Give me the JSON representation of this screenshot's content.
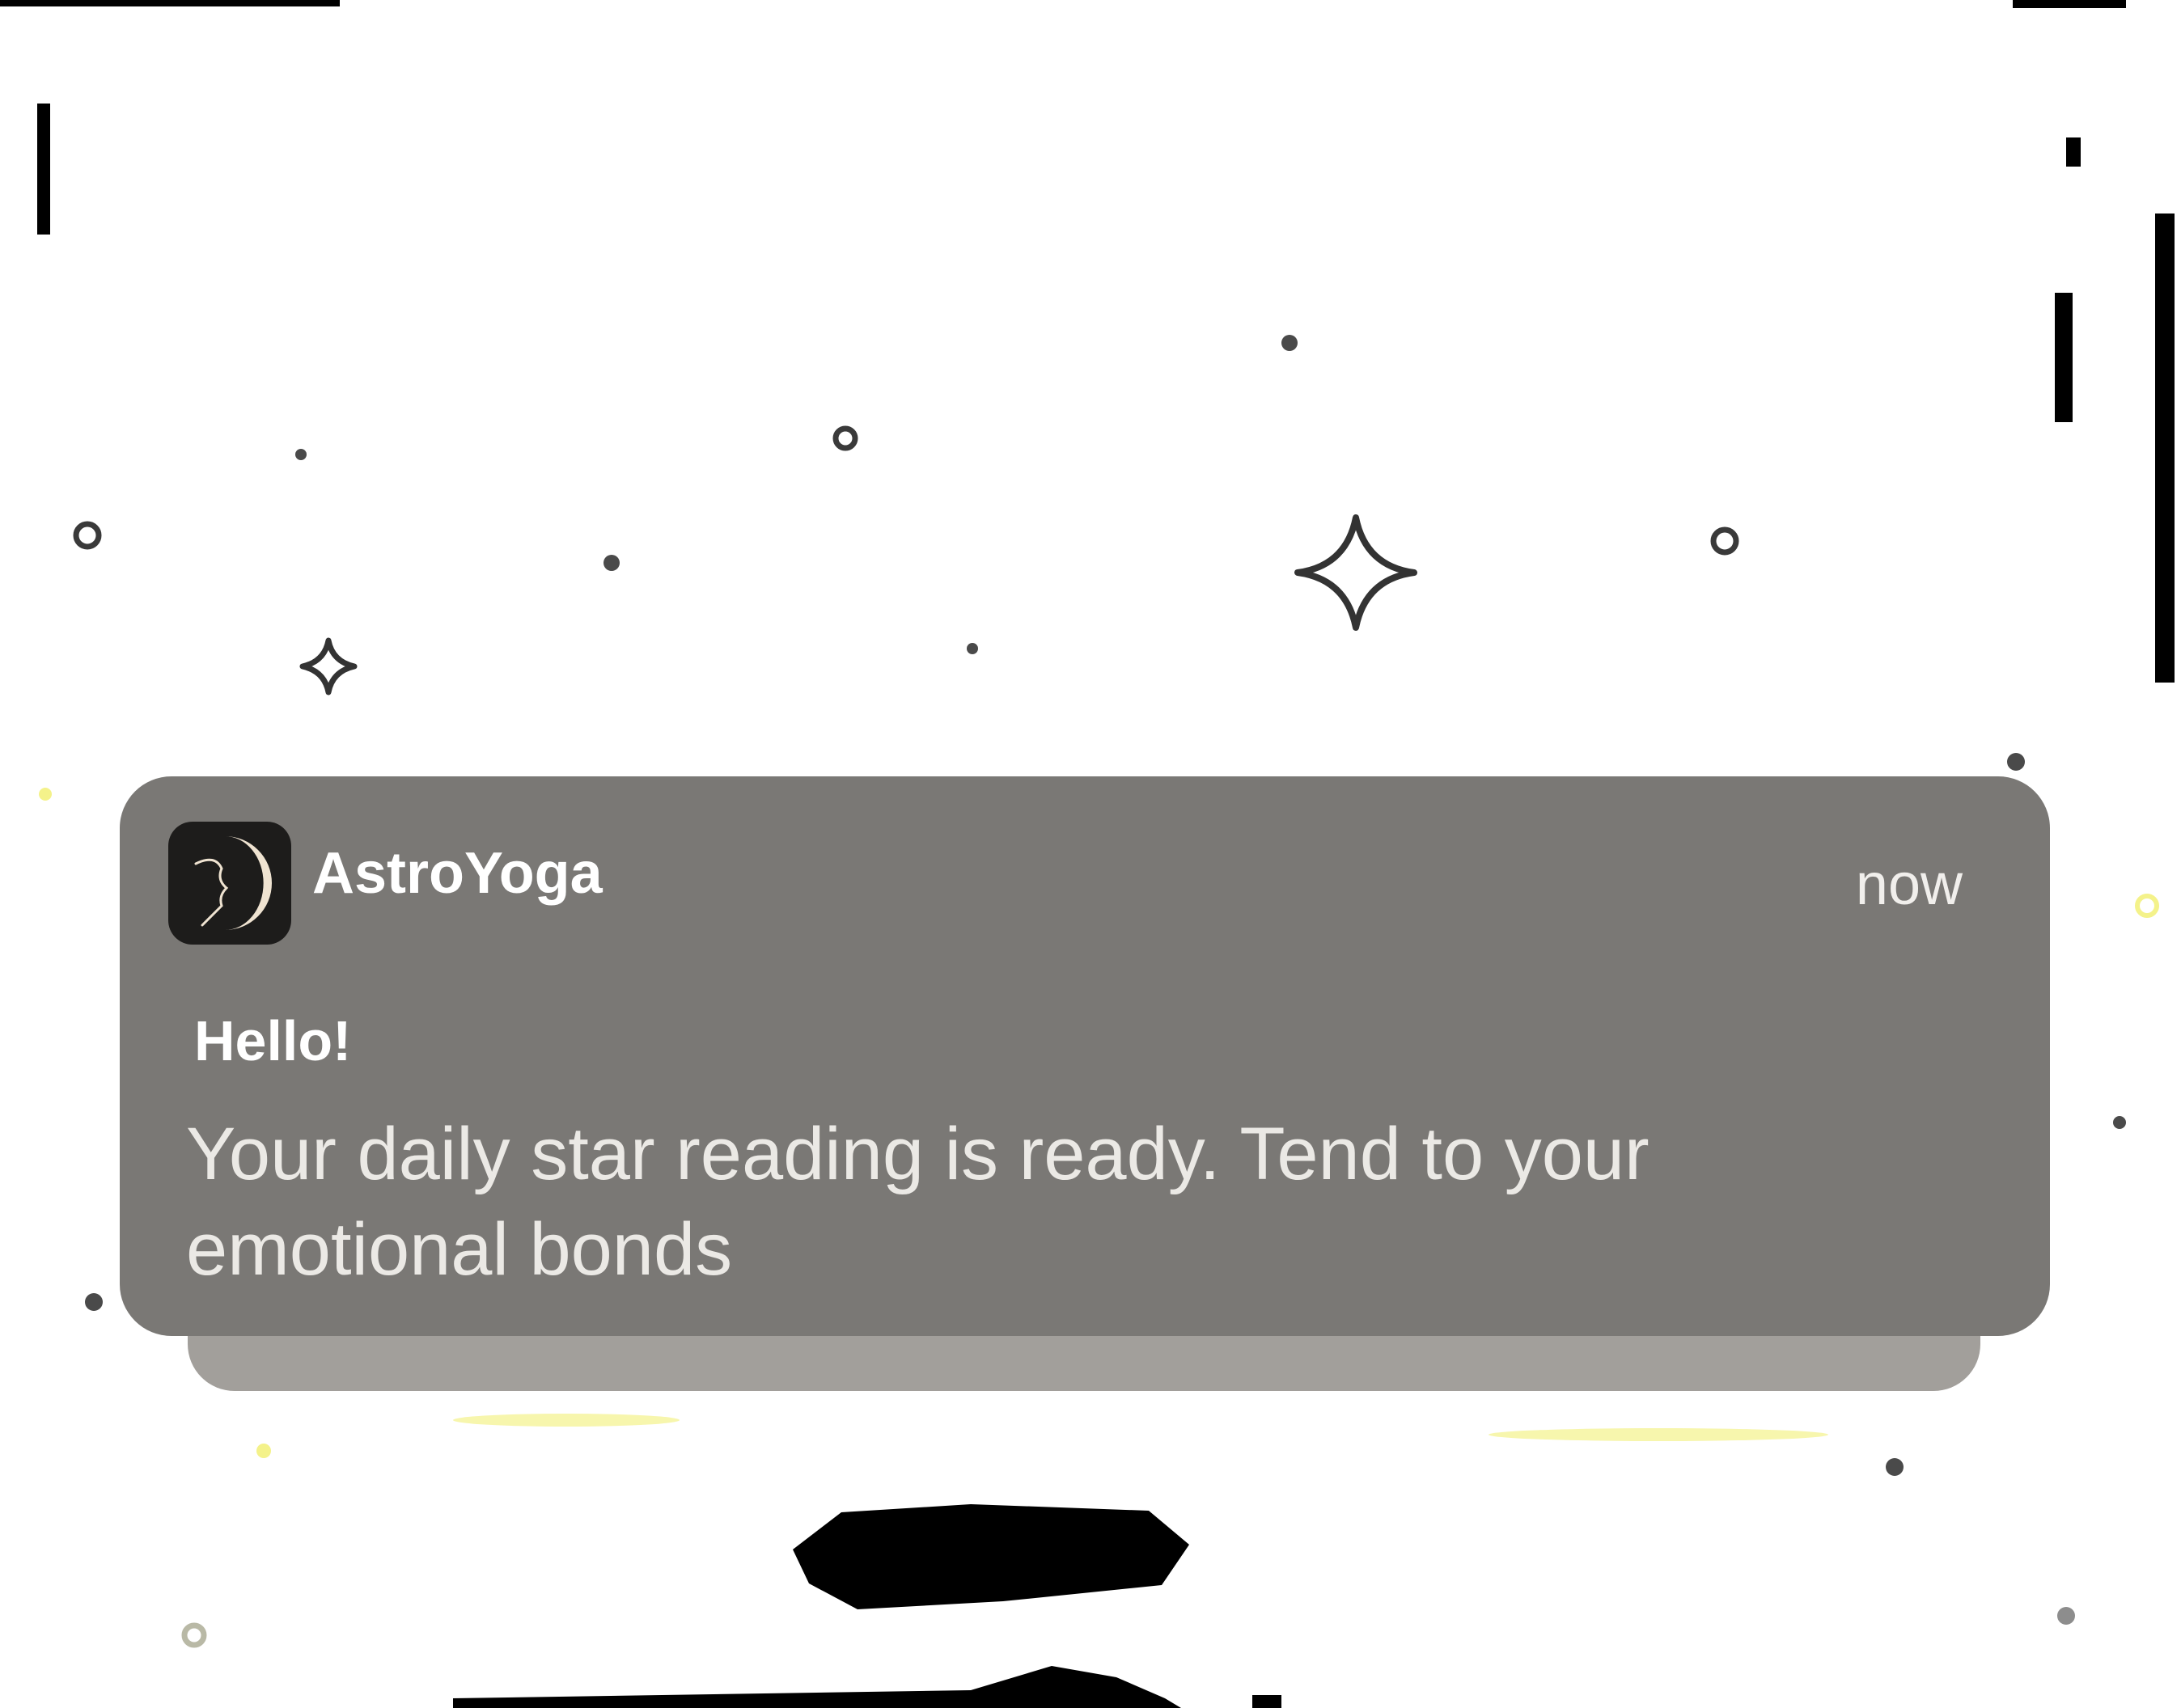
{
  "notification": {
    "app_name": "AstroYoga",
    "timestamp": "now",
    "title": "Hello!",
    "body": "Your daily star reading is ready. Tend to your emotional bonds",
    "app_icon": "crescent-moon-face-icon"
  },
  "decorations": {
    "icons": [
      "sparkle-icon",
      "star-dot-icon",
      "star-ring-icon"
    ]
  },
  "colors": {
    "background": "#ffffff",
    "notification_background": "#7a7875",
    "stacked_card_background": "#a29f9b",
    "app_icon_background": "#1d1c1b",
    "moon": "#efe3d1",
    "text_primary": "#ffffff",
    "text_secondary": "#ebe9e5",
    "star_outline": "#3a3a3a"
  }
}
